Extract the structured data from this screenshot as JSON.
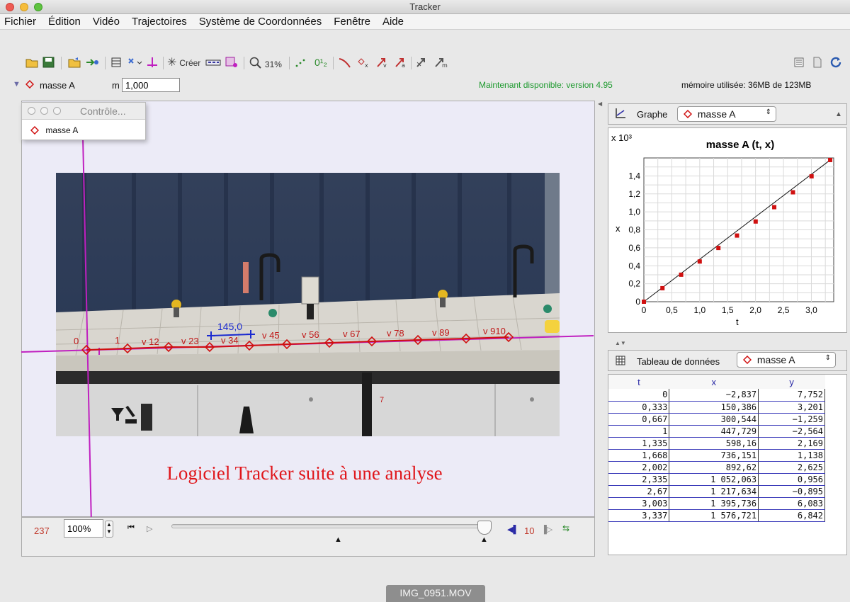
{
  "window": {
    "title": "Tracker"
  },
  "menu": [
    "Fichier",
    "Édition",
    "Vidéo",
    "Trajectoires",
    "Système de Coordonnées",
    "Fenêtre",
    "Aide"
  ],
  "toolbar": {
    "create_label": "Créer",
    "zoom_label": "31%",
    "numbering_label": "0¹₂"
  },
  "track_row": {
    "track_name": "masse A",
    "mass_label": "m",
    "mass_value": "1,000",
    "available": "Maintenant disponible: version 4.95",
    "memory": "mémoire utilisée: 36MB de 123MB"
  },
  "control_window": {
    "title": "Contrôle...",
    "track": "masse A"
  },
  "video_overlay": {
    "calibration_label": "145,0",
    "point_labels": [
      "0",
      "1",
      "v 12",
      "v 23",
      "v 34",
      "v 45",
      "v 56",
      "v 67",
      "v 78",
      "v 89",
      "v 910"
    ],
    "frame_mark": "7"
  },
  "caption": "Logiciel Tracker suite à une analyse",
  "player": {
    "frame_number": "237",
    "zoom": "100%",
    "step_value": "10"
  },
  "graph": {
    "tab_label": "Graphe",
    "track_selector": "masse A",
    "title": "masse A (t, x)",
    "xlabel": "t",
    "ylabel": "x",
    "y_multiplier": "x 10³"
  },
  "table": {
    "tab_label": "Tableau de données",
    "track_selector": "masse A",
    "columns": [
      "t",
      "x",
      "y"
    ],
    "rows": [
      [
        "0",
        "−2,837",
        "7,752"
      ],
      [
        "0,333",
        "150,386",
        "3,201"
      ],
      [
        "0,667",
        "300,544",
        "−1,259"
      ],
      [
        "1",
        "447,729",
        "−2,564"
      ],
      [
        "1,335",
        "598,16",
        "2,169"
      ],
      [
        "1,668",
        "736,151",
        "1,138"
      ],
      [
        "2,002",
        "892,62",
        "2,625"
      ],
      [
        "2,335",
        "1 052,063",
        "0,956"
      ],
      [
        "2,67",
        "1 217,634",
        "−0,895"
      ],
      [
        "3,003",
        "1 395,736",
        "6,083"
      ],
      [
        "3,337",
        "1 576,721",
        "6,842"
      ]
    ]
  },
  "footer": {
    "filename": "IMG_0951.MOV"
  },
  "chart_data": {
    "type": "scatter",
    "title": "masse A (t, x)",
    "xlabel": "t",
    "ylabel": "x",
    "y_multiplier": "x 10³",
    "x": [
      0,
      0.333,
      0.667,
      1,
      1.335,
      1.668,
      2.002,
      2.335,
      2.67,
      3.003,
      3.337
    ],
    "y": [
      -0.002837,
      0.150386,
      0.300544,
      0.447729,
      0.59816,
      0.736151,
      0.89262,
      1.052063,
      1.217634,
      1.395736,
      1.576721
    ],
    "xlim": [
      0,
      3.4
    ],
    "ylim": [
      0,
      1.6
    ],
    "xticks": [
      "0",
      "0,5",
      "1,0",
      "1,5",
      "2,0",
      "2,5",
      "3,0"
    ],
    "yticks": [
      "0",
      "0,2",
      "0,4",
      "0,6",
      "0,8",
      "1,0",
      "1,2",
      "1,4"
    ],
    "grid": true,
    "fit_line": true,
    "point_color": "#d01010"
  }
}
